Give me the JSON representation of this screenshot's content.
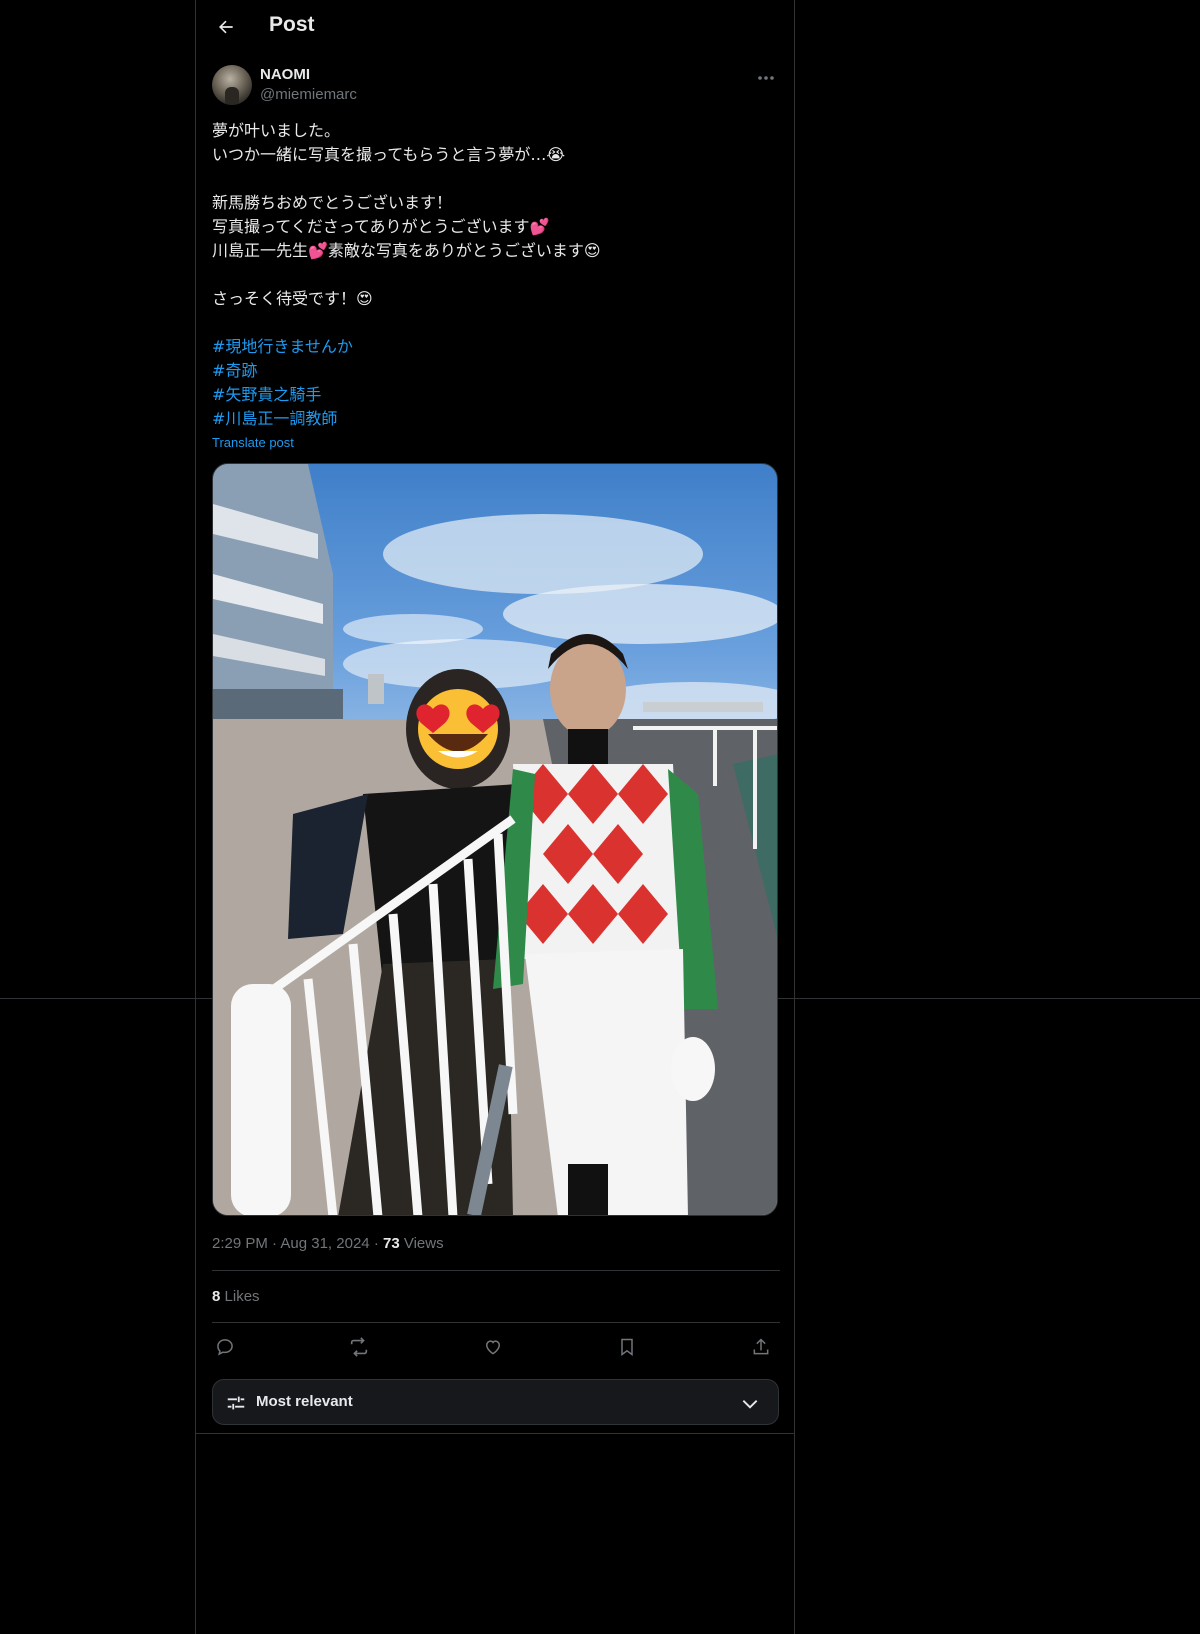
{
  "header": {
    "title": "Post"
  },
  "author": {
    "display_name": "NAOMI",
    "handle": "@miemiemarc"
  },
  "post": {
    "lines": [
      "夢が叶いました。",
      "いつか一緒に写真を撮ってもらうと言う夢が…😭",
      "",
      "新馬勝ちおめでとうございます！",
      "写真撮ってくださってありがとうございます💕",
      "川島正一先生💕素敵な写真をありがとうございます😍",
      "",
      "さっそく待受です！😍",
      ""
    ],
    "hashtags": [
      "#現地行きませんか",
      "#奇跡",
      "#矢野貴之騎手",
      "#川島正一調教師"
    ],
    "translate_label": "Translate post"
  },
  "meta": {
    "time": "2:29 PM",
    "date": "Aug 31, 2024",
    "views_count": "73",
    "views_label": "Views",
    "separator": "·"
  },
  "engagement": {
    "likes_count": "8",
    "likes_label": "Likes"
  },
  "actions": [
    "reply-icon",
    "repost-icon",
    "like-icon",
    "bookmark-icon",
    "share-icon"
  ],
  "replies_sort": {
    "label": "Most relevant"
  },
  "colors": {
    "accent": "#1d9bf0",
    "muted": "#71767b",
    "text": "#e7e9ea",
    "border": "#2f3336"
  }
}
